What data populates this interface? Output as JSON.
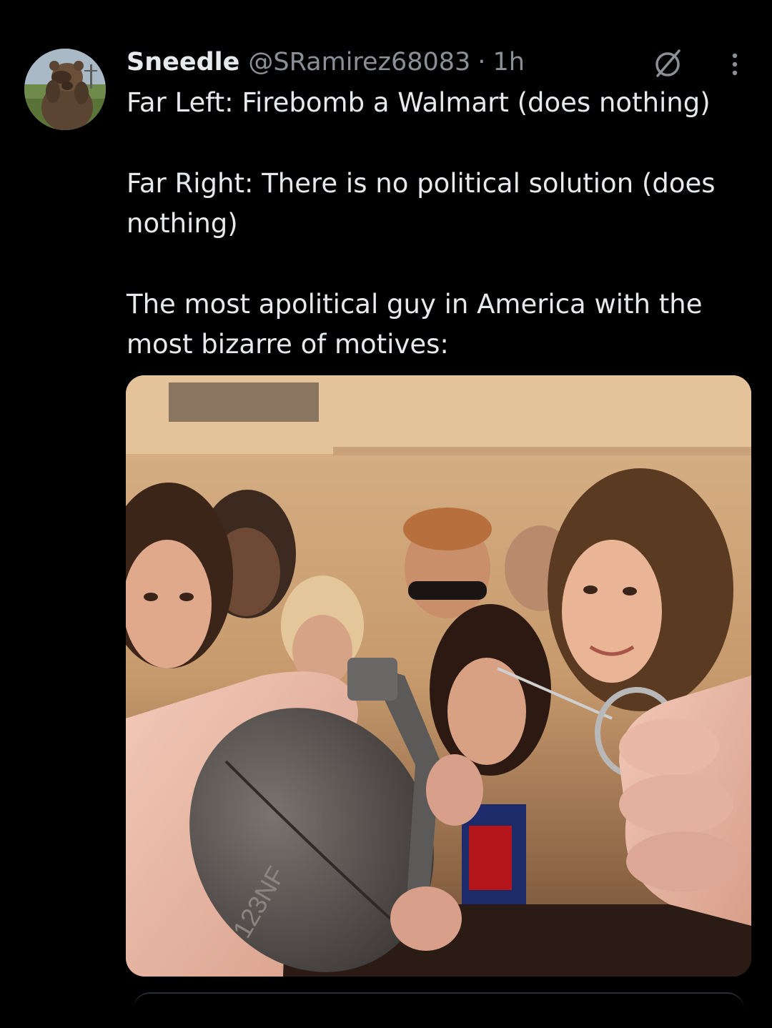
{
  "tweet": {
    "author": {
      "display_name": "Sneedle",
      "handle": "@SRamirez68083",
      "avatar_icon": "bear-photo-avatar"
    },
    "separator": "·",
    "timestamp": "1h",
    "paragraphs": [
      "Far Left: Firebomb a Walmart (does nothing)",
      "Far Right: There is no political solution (does nothing)",
      "The most apolitical guy in America with the most bizarre of motives:"
    ],
    "media": {
      "description_icon": "party-grenade-photo",
      "grenade_marking": "123NF"
    },
    "icons": [
      "grok-icon",
      "more-vertical-icon"
    ]
  },
  "colors": {
    "background": "#000000",
    "text_primary": "#e7e9ea",
    "text_secondary": "#8b9096"
  }
}
